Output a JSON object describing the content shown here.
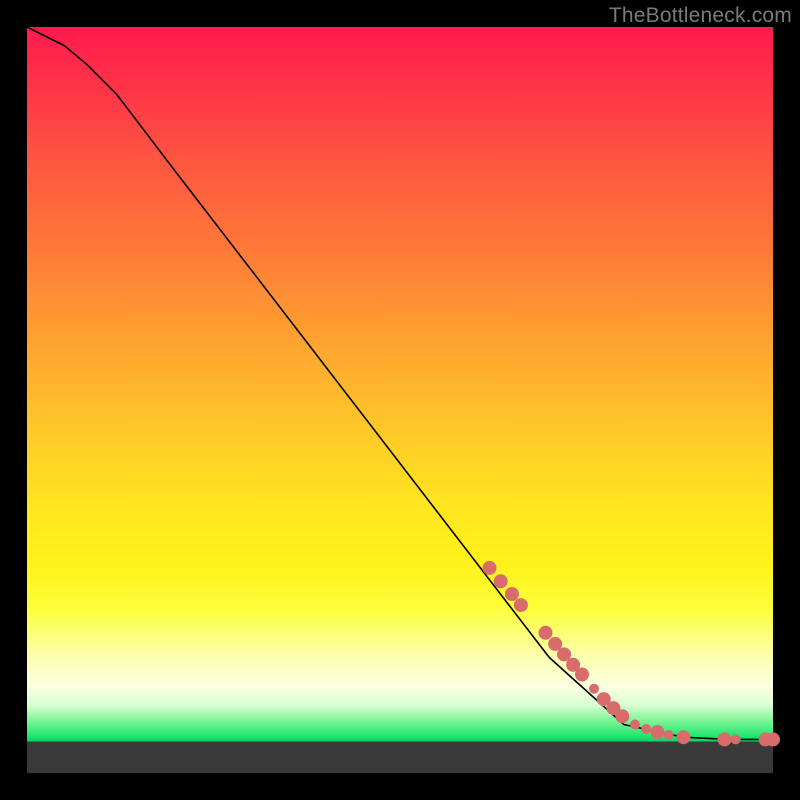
{
  "watermark": "TheBottleneck.com",
  "chart_data": {
    "type": "line",
    "title": "",
    "xlabel": "",
    "ylabel": "",
    "xlim": [
      0,
      100
    ],
    "ylim": [
      0,
      100
    ],
    "grid": false,
    "series": [
      {
        "name": "curve",
        "x": [
          0,
          2,
          5,
          8,
          12,
          20,
          30,
          40,
          50,
          60,
          70,
          80,
          88,
          92,
          95,
          97,
          99,
          100
        ],
        "y": [
          100,
          99,
          97.5,
          95,
          91,
          80.5,
          67.5,
          54.5,
          41.5,
          28.5,
          15.5,
          6.5,
          4.8,
          4.6,
          4.5,
          4.5,
          4.5,
          4.5
        ]
      }
    ],
    "markers": {
      "name": "cluster-points",
      "color": "#d86b6b",
      "radius_small": 5,
      "radius_large": 7,
      "points": [
        {
          "x": 62,
          "y": 27.5,
          "r": 7
        },
        {
          "x": 63.5,
          "y": 25.7,
          "r": 7
        },
        {
          "x": 65,
          "y": 24.0,
          "r": 7
        },
        {
          "x": 66.2,
          "y": 22.5,
          "r": 7
        },
        {
          "x": 69.5,
          "y": 18.8,
          "r": 7
        },
        {
          "x": 70.8,
          "y": 17.3,
          "r": 7
        },
        {
          "x": 72.0,
          "y": 15.9,
          "r": 7
        },
        {
          "x": 73.2,
          "y": 14.5,
          "r": 7
        },
        {
          "x": 74.4,
          "y": 13.2,
          "r": 7
        },
        {
          "x": 76.0,
          "y": 11.3,
          "r": 5
        },
        {
          "x": 77.3,
          "y": 9.9,
          "r": 7
        },
        {
          "x": 78.6,
          "y": 8.7,
          "r": 7
        },
        {
          "x": 79.8,
          "y": 7.6,
          "r": 7
        },
        {
          "x": 81.5,
          "y": 6.5,
          "r": 5
        },
        {
          "x": 83.0,
          "y": 5.9,
          "r": 5
        },
        {
          "x": 84.5,
          "y": 5.5,
          "r": 7
        },
        {
          "x": 86.0,
          "y": 5.1,
          "r": 5
        },
        {
          "x": 88.0,
          "y": 4.8,
          "r": 7
        },
        {
          "x": 93.5,
          "y": 4.5,
          "r": 7
        },
        {
          "x": 95.0,
          "y": 4.5,
          "r": 5
        },
        {
          "x": 99.0,
          "y": 4.5,
          "r": 7
        },
        {
          "x": 100.0,
          "y": 4.5,
          "r": 7
        }
      ]
    },
    "gradient_bands": [
      {
        "name": "red",
        "y_from": 100,
        "y_to": 70
      },
      {
        "name": "orange",
        "y_from": 70,
        "y_to": 45
      },
      {
        "name": "yellow",
        "y_from": 45,
        "y_to": 18
      },
      {
        "name": "pale",
        "y_from": 18,
        "y_to": 9
      },
      {
        "name": "green",
        "y_from": 9,
        "y_to": 4.2
      },
      {
        "name": "gray-floor",
        "y_from": 4.2,
        "y_to": 0
      }
    ]
  }
}
